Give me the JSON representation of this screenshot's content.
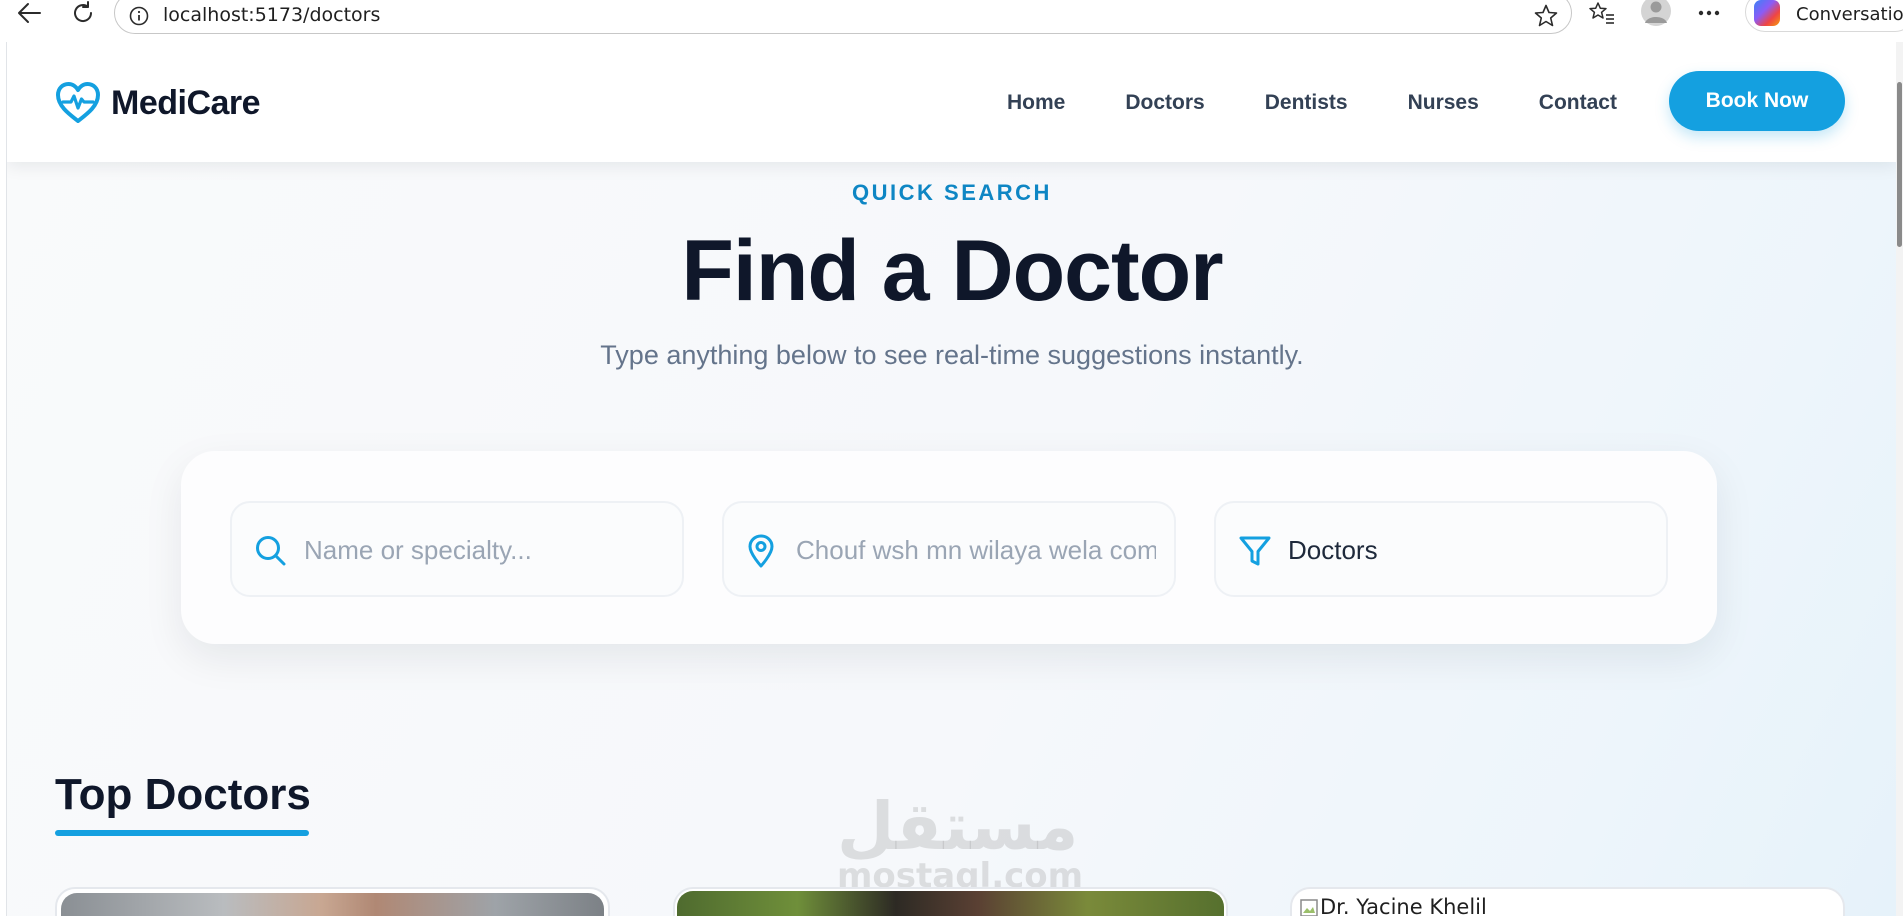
{
  "browser": {
    "url": "localhost:5173/doctors",
    "conversation_label": "Conversation"
  },
  "brand": {
    "name": "MediCare",
    "accent_color": "#14a0e0"
  },
  "nav": {
    "links": [
      "Home",
      "Doctors",
      "Dentists",
      "Nurses",
      "Contact"
    ],
    "book_label": "Book Now"
  },
  "hero": {
    "eyebrow": "QUICK SEARCH",
    "title": "Find a Doctor",
    "subtitle": "Type anything below to see real-time suggestions instantly."
  },
  "search": {
    "name_placeholder": "Name or specialty...",
    "location_placeholder": "Chouf wsh mn wilaya wela commune",
    "filter_value": "Doctors",
    "icons": [
      "search-icon",
      "map-pin-icon",
      "filter-icon"
    ]
  },
  "top_doctors": {
    "title": "Top Doctors",
    "cards": [
      {
        "image_alt": ""
      },
      {
        "image_alt": ""
      },
      {
        "image_alt": "Dr. Yacine Khelil"
      }
    ]
  },
  "watermark": {
    "arabic": "مستقل",
    "latin": "mostaql.com"
  }
}
